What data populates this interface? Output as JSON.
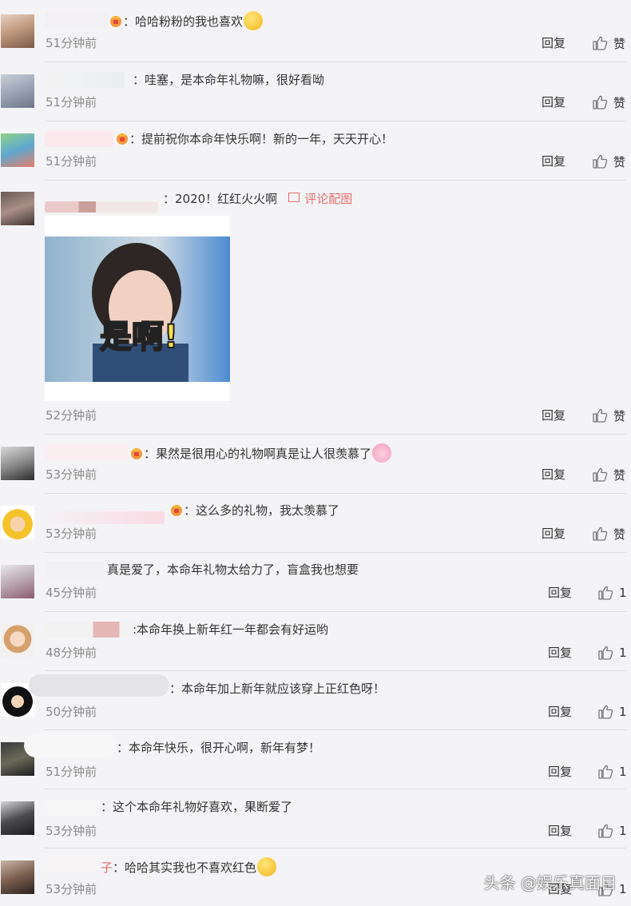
{
  "comments": [
    {
      "text": "：哈哈粉粉的我也喜欢",
      "time": "51分钟前",
      "reply": "回复",
      "like": "赞"
    },
    {
      "text": "：哇塞，是本命年礼物嘛，很好看呦",
      "time": "51分钟前",
      "reply": "回复",
      "like": "赞"
    },
    {
      "text": "：提前祝你本命年快乐啊！新的一年，天天开心！",
      "time": "51分钟前",
      "reply": "回复",
      "like": "赞"
    },
    {
      "text": "：2020！红红火火啊",
      "time": "52分钟前",
      "reply": "回复",
      "like": "赞",
      "pic_link": "评论配图",
      "image_caption": "是啊!"
    },
    {
      "text": "：果然是很用心的礼物啊真是让人很羡慕了",
      "time": "53分钟前",
      "reply": "回复",
      "like": "赞"
    },
    {
      "text": "：这么多的礼物，我太羡慕了",
      "time": "53分钟前",
      "reply": "回复",
      "like": "赞"
    },
    {
      "text": "真是爱了，本命年礼物太给力了，盲盒我也想要",
      "time": "45分钟前",
      "reply": "回复",
      "like": "1"
    },
    {
      "text": ":本命年换上新年红一年都会有好运哟",
      "time": "48分钟前",
      "reply": "回复",
      "like": "1"
    },
    {
      "text": "：本命年加上新年就应该穿上正红色呀！",
      "time": "50分钟前",
      "reply": "回复",
      "like": "1"
    },
    {
      "text": "：本命年快乐，很开心啊，新年有梦！",
      "time": "51分钟前",
      "reply": "回复",
      "like": "1"
    },
    {
      "text": "：这个本命年礼物好喜欢，果断爱了",
      "time": "53分钟前",
      "reply": "回复",
      "like": "1"
    },
    {
      "text": "：哈哈其实我也不喜欢红色",
      "name_tail": "子",
      "time": "53分钟前",
      "reply": "回复",
      "like": "1"
    }
  ],
  "watermark": "头条 @娱乐真面目",
  "colors": {
    "background": "#f4f4f6",
    "link": "#e46e6e",
    "time": "#8a8a8a",
    "divider": "#dcdcdf"
  }
}
